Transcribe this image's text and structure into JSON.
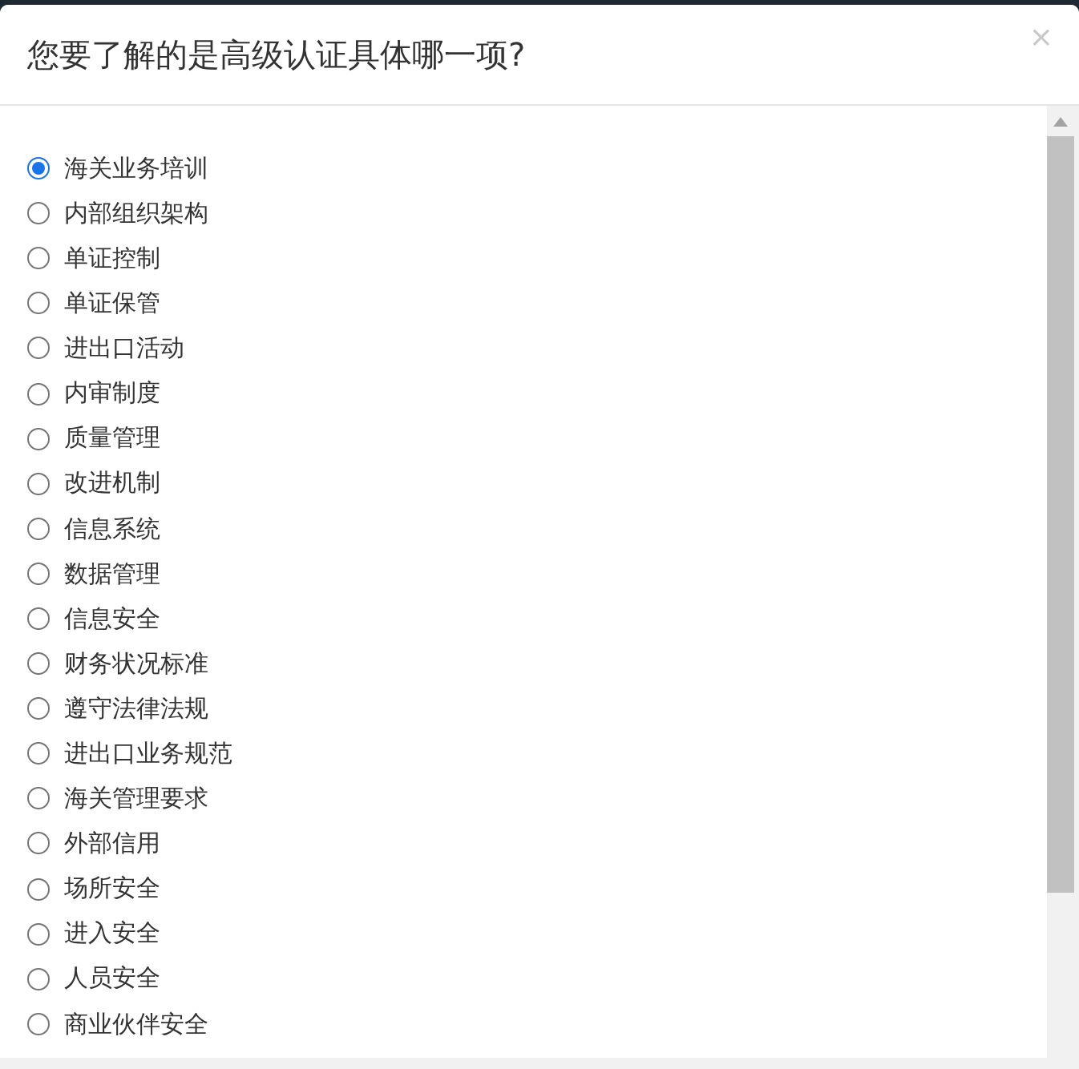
{
  "dialog": {
    "title": "您要了解的是高级认证具体哪一项?",
    "close": "×"
  },
  "options": [
    {
      "label": "海关业务培训",
      "selected": true
    },
    {
      "label": "内部组织架构",
      "selected": false
    },
    {
      "label": "单证控制",
      "selected": false
    },
    {
      "label": "单证保管",
      "selected": false
    },
    {
      "label": "进出口活动",
      "selected": false
    },
    {
      "label": "内审制度",
      "selected": false
    },
    {
      "label": "质量管理",
      "selected": false
    },
    {
      "label": "改进机制",
      "selected": false
    },
    {
      "label": "信息系统",
      "selected": false
    },
    {
      "label": "数据管理",
      "selected": false
    },
    {
      "label": "信息安全",
      "selected": false
    },
    {
      "label": "财务状况标准",
      "selected": false
    },
    {
      "label": "遵守法律法规",
      "selected": false
    },
    {
      "label": "进出口业务规范",
      "selected": false
    },
    {
      "label": "海关管理要求",
      "selected": false
    },
    {
      "label": "外部信用",
      "selected": false
    },
    {
      "label": "场所安全",
      "selected": false
    },
    {
      "label": "进入安全",
      "selected": false
    },
    {
      "label": "人员安全",
      "selected": false
    },
    {
      "label": "商业伙伴安全",
      "selected": false
    }
  ]
}
